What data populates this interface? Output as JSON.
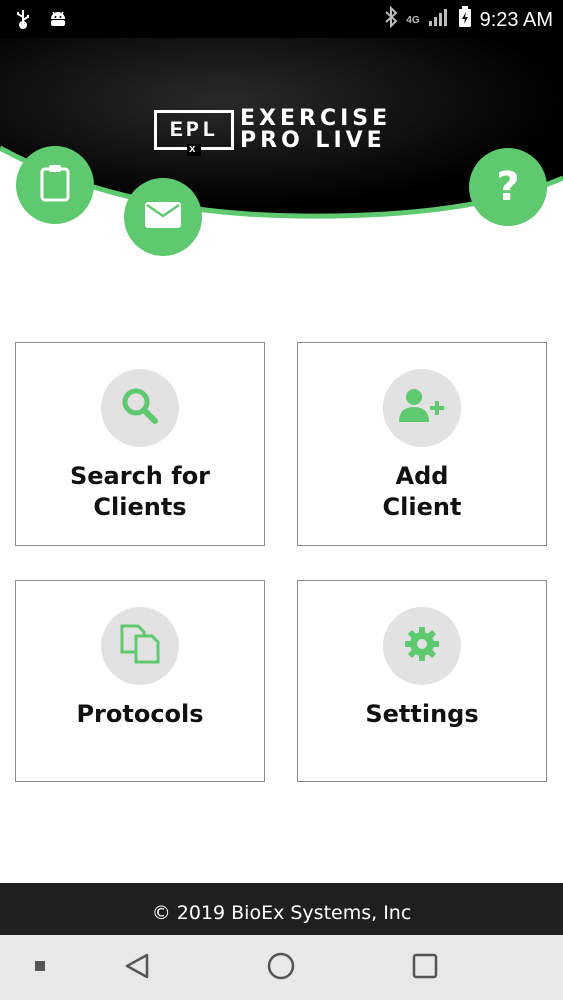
{
  "status_bar": {
    "time": "9:23 AM",
    "network": "4G",
    "icons": [
      "usb-icon",
      "android-debug-icon",
      "bluetooth-icon",
      "signal-icon",
      "battery-icon"
    ]
  },
  "header": {
    "logo_box_text": "EPL",
    "logo_box_subscript": "x",
    "logo_line1": "EXERCISE",
    "logo_line2": "PRO LIVE",
    "buttons": [
      "clipboard-icon",
      "mail-icon",
      "help-icon"
    ],
    "help_glyph": "?"
  },
  "menu": {
    "items": [
      {
        "label": "Search for\nClients",
        "icon": "search-icon"
      },
      {
        "label": "Add\nClient",
        "icon": "add-user-icon"
      },
      {
        "label": "Protocols",
        "icon": "documents-icon"
      },
      {
        "label": "Settings",
        "icon": "gear-icon"
      }
    ]
  },
  "footer": {
    "text": "© 2019 BioEx Systems, Inc"
  },
  "colors": {
    "accent": "#5ec96f",
    "header_bg": "#000000",
    "footer_bg": "#1f1f1f",
    "icon_circle_bg": "#e2e2e2",
    "navbar_bg": "#e8e8e8"
  }
}
